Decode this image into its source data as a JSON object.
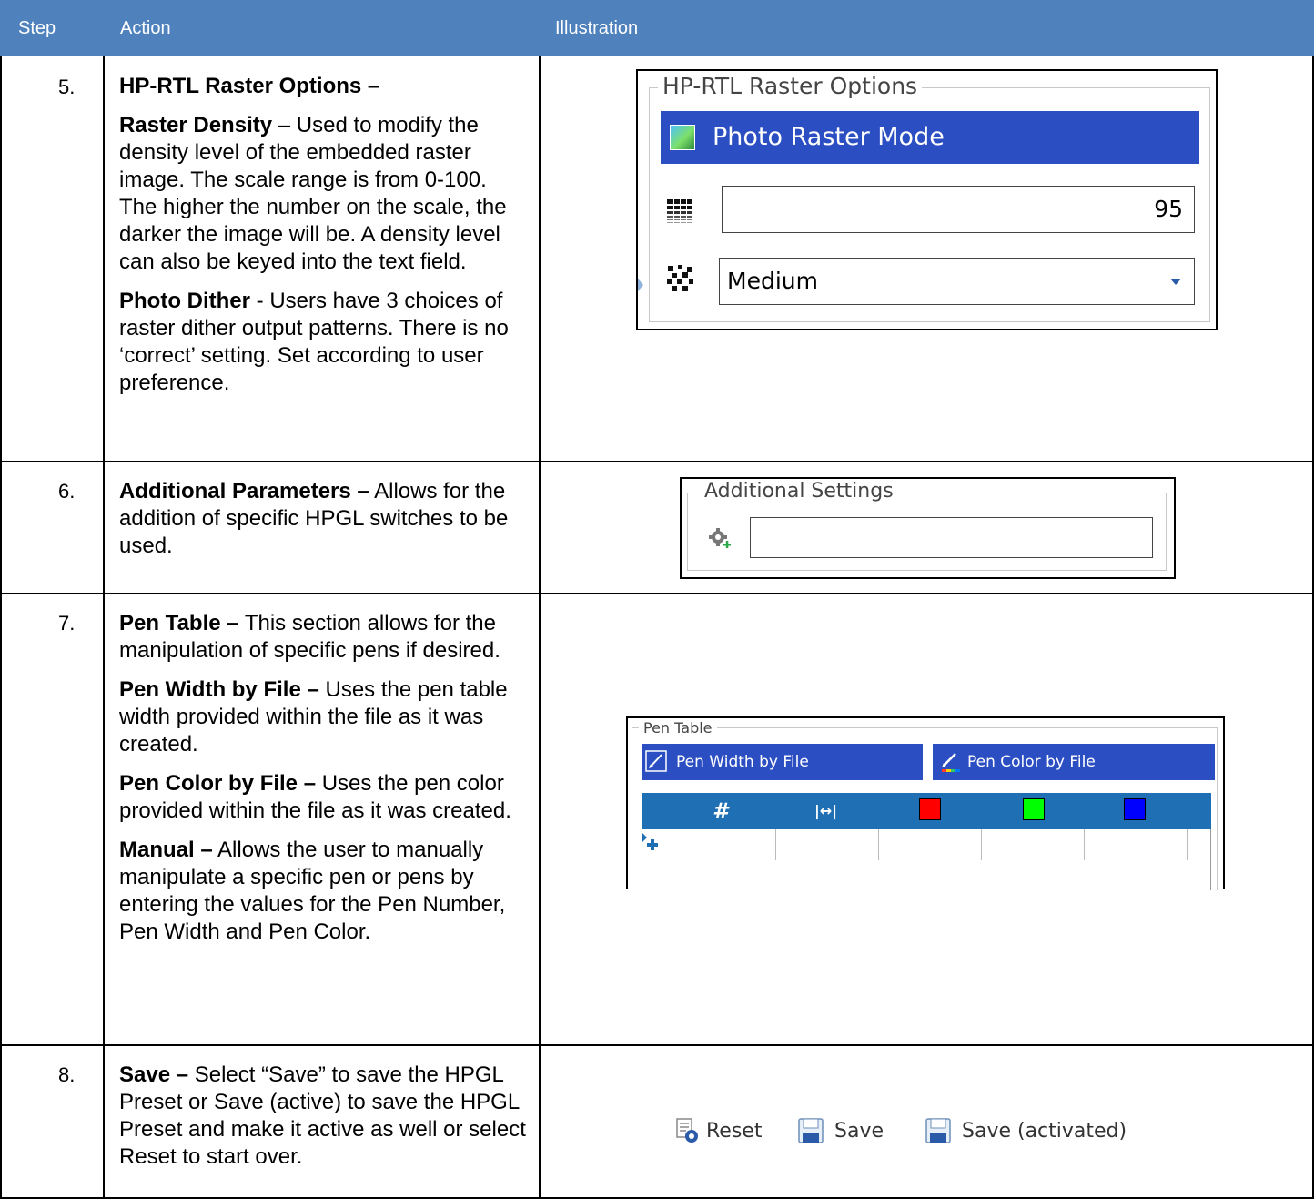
{
  "header": {
    "step": "Step",
    "action": "Action",
    "illustration": "Illustration"
  },
  "rows": [
    {
      "step": "5.",
      "paragraphs": [
        {
          "bold": "HP-RTL Raster Options –",
          "text": ""
        },
        {
          "bold": "Raster Density",
          "text": " – Used to modify the density level of the embedded raster image. The scale range is from 0-100. The higher the number on the scale, the darker the image will be.  A density level can also be keyed into the text field."
        },
        {
          "bold": "Photo Dither",
          "text": " - Users have 3 choices of raster dither output patterns. There is no ‘correct’ setting.   Set according to user preference."
        }
      ]
    },
    {
      "step": "6.",
      "paragraphs": [
        {
          "bold": "Additional Parameters –",
          "text": " Allows for the addition of specific HPGL switches to be used."
        }
      ]
    },
    {
      "step": "7.",
      "paragraphs": [
        {
          "bold": "Pen Table –",
          "text": " This section allows for the manipulation of specific pens if desired."
        },
        {
          "bold": "Pen Width by File –",
          "text": " Uses the pen table width provided within the file as it was created."
        },
        {
          "bold": "Pen Color by File –",
          "text": " Uses the pen color provided within the file as it was created."
        },
        {
          "bold": "Manual –",
          "text": " Allows the user to manually manipulate a specific pen or pens by entering the values for the Pen Number, Pen Width and Pen Color."
        }
      ]
    },
    {
      "step": "8.",
      "paragraphs": [
        {
          "bold": "Save –",
          "text": " Select “Save” to save the HPGL Preset or Save (active) to save the HPGL Preset and make it active as well or select Reset to start over."
        }
      ]
    }
  ],
  "raster": {
    "title": "HP-RTL Raster Options",
    "mode_button": "Photo Raster Mode",
    "density_value": "95",
    "dither_value": "Medium"
  },
  "additional": {
    "title": "Additional Settings",
    "value": ""
  },
  "pen_table": {
    "title": "Pen Table",
    "width_button": "Pen Width by File",
    "color_button": "Pen Color by File",
    "columns": [
      "#",
      "|↔|",
      "red",
      "green",
      "blue"
    ],
    "column_colors": {
      "red": "#ff0000",
      "green": "#00ff00",
      "blue": "#0000ff"
    },
    "header_bg": "#1f6fb5"
  },
  "save_bar": {
    "reset": "Reset",
    "save": "Save",
    "save_activated": "Save (activated)"
  },
  "colors": {
    "header_bg": "#4f81bd",
    "button_blue": "#2b4ec2"
  }
}
